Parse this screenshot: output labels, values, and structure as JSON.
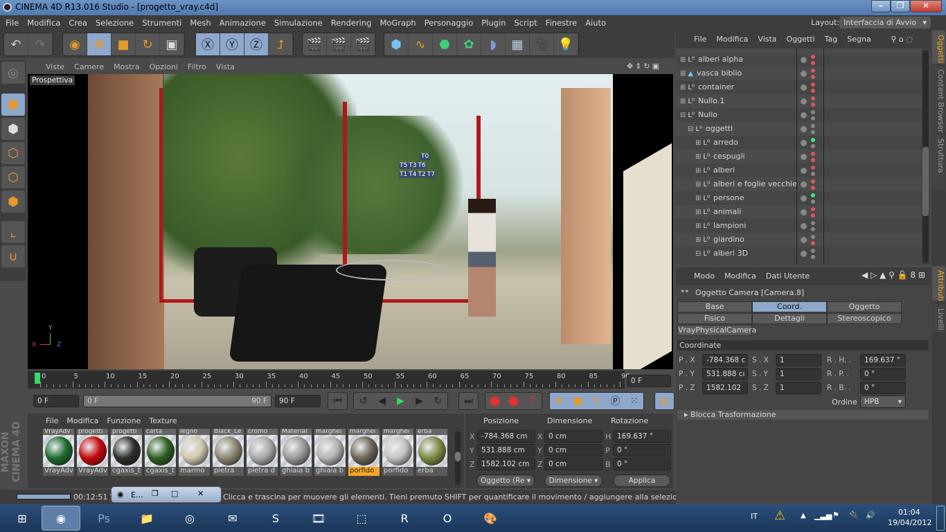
{
  "window": {
    "title": "CINEMA 4D R13.016 Studio - [progetto_vray.c4d]",
    "min": "–",
    "max": "❐",
    "close": "✕"
  },
  "menu": [
    "File",
    "Modifica",
    "Crea",
    "Selezione",
    "Strumenti",
    "Mesh",
    "Animazione",
    "Simulazione",
    "Rendering",
    "MoGraph",
    "Personaggio",
    "Plugin",
    "Script",
    "Finestre",
    "Aiuto"
  ],
  "layout": {
    "label": "Layout:",
    "value": "Interfaccia di Avvio"
  },
  "viewport": {
    "menu": [
      "Viste",
      "Camere",
      "Mostra",
      "Opzioni",
      "Filtro",
      "Vista"
    ],
    "label": "Prospettiva",
    "axes": {
      "x": "X",
      "y": "Y",
      "z": "Z"
    },
    "tags": [
      "T0",
      "T5",
      "T3",
      "T6",
      "T1",
      "T4",
      "T2",
      "T7"
    ]
  },
  "timeline": {
    "ticks": [
      "0",
      "5",
      "10",
      "15",
      "20",
      "25",
      "30",
      "35",
      "40",
      "45",
      "50",
      "55",
      "60",
      "65",
      "70",
      "75",
      "80",
      "85",
      "90"
    ],
    "current": "0 F",
    "start": "0 F",
    "range_start": "0 F",
    "range_end": "90 F",
    "end": "90 F"
  },
  "materials": {
    "menu": [
      "File",
      "Modifica",
      "Funzione",
      "Texture"
    ],
    "top_labels": [
      "VrayAdv",
      "progetti",
      "progetti",
      "carta",
      "legno",
      "Black_Le",
      "cromo",
      "Material",
      "marghei",
      "marghei",
      "marghei",
      "erba"
    ],
    "items": [
      {
        "name": "VrayAdv",
        "color": "#1f6b2e"
      },
      {
        "name": "VrayAdv",
        "color": "#c4080d"
      },
      {
        "name": "cgaxis_t",
        "color": "#2e2e2a"
      },
      {
        "name": "cgaxis_t",
        "color": "#2f5e22"
      },
      {
        "name": "marmo",
        "color": "#cfc7ad"
      },
      {
        "name": "pietra",
        "color": "#8c8670"
      },
      {
        "name": "pietra d",
        "color": "#a9a9a9"
      },
      {
        "name": "ghiaia b",
        "color": "#9a9a9a"
      },
      {
        "name": "ghiaia b",
        "color": "#b3b3b3"
      },
      {
        "name": "porfido",
        "color": "#6e6556",
        "selected": true
      },
      {
        "name": "porfido",
        "color": "#c3c3c3"
      },
      {
        "name": "erba",
        "color": "#7b8a45"
      }
    ],
    "brand": "MAXON CINEMA 4D"
  },
  "coords": {
    "headers": [
      "Posizione",
      "Dimensione",
      "Rotazione"
    ],
    "rows": [
      {
        "a": "X",
        "pos": "-784.368 cm",
        "b": "X",
        "dim": "0 cm",
        "c": "H",
        "rot": "169.637 °"
      },
      {
        "a": "Y",
        "pos": "531.888 cm",
        "b": "Y",
        "dim": "0 cm",
        "c": "P",
        "rot": "0 °"
      },
      {
        "a": "Z",
        "pos": "1582.102 cm",
        "b": "Z",
        "dim": "0 cm",
        "c": "B",
        "rot": "0 °"
      }
    ],
    "mode": "Oggetto (Re",
    "size": "Dimensione",
    "apply": "Applica"
  },
  "status": {
    "time": "00:12:51 Vr",
    "text": "Clicca e trascina per muovere gli elementi. Tieni premuto SHIFT per quantificare il movimento / aggiungere alla selezione in mod",
    "popup": "E..."
  },
  "objects": {
    "menu": [
      "File",
      "Modifica",
      "Vista",
      "Oggetti",
      "Tag",
      "Segna"
    ],
    "items": [
      {
        "name": "alberi alpha",
        "indent": 0,
        "top": "#e05555",
        "bot": "#e05555"
      },
      {
        "name": "vasca biblio",
        "indent": 0,
        "top": "#e05555",
        "bot": "#e05555",
        "icon": "cone"
      },
      {
        "name": "container",
        "indent": 0,
        "top": "#e05555",
        "bot": "#e05555"
      },
      {
        "name": "Nullo.1",
        "indent": 0,
        "top": "#e05555",
        "bot": "#e05555"
      },
      {
        "name": "Nullo",
        "indent": 0,
        "top": "#888",
        "bot": "#888",
        "open": true
      },
      {
        "name": "oggetti",
        "indent": 1,
        "top": "#888",
        "bot": "#888",
        "open": true
      },
      {
        "name": "arredo",
        "indent": 2,
        "top": "#4ee08a",
        "bot": "#888"
      },
      {
        "name": "cespugli",
        "indent": 2,
        "top": "#e05555",
        "bot": "#e05555"
      },
      {
        "name": "alberi",
        "indent": 2,
        "top": "#e05555",
        "bot": "#888"
      },
      {
        "name": "alberi e foglie vecchie",
        "indent": 2,
        "top": "#e05555",
        "bot": "#e05555"
      },
      {
        "name": "persone",
        "indent": 2,
        "top": "#4ee08a",
        "bot": "#888"
      },
      {
        "name": "animali",
        "indent": 2,
        "top": "#e05555",
        "bot": "#e05555"
      },
      {
        "name": "lampioni",
        "indent": 2,
        "top": "#888",
        "bot": "#888"
      },
      {
        "name": "giardino",
        "indent": 2,
        "top": "#888",
        "bot": "#e05555"
      },
      {
        "name": "alberi 3D",
        "indent": 2,
        "top": "#888",
        "bot": "#888",
        "open": true
      }
    ]
  },
  "attributes": {
    "menu": [
      "Modo",
      "Modifica",
      "Dati Utente"
    ],
    "title": "Oggetto Camera [Camera.8]",
    "tabs": [
      "Base",
      "Coord.",
      "Oggetto",
      "Fisico",
      "Dettagli",
      "Stereoscopico",
      "VrayPhysicalCamera"
    ],
    "active_tab": "Coord.",
    "section": "Coordinate",
    "rows": [
      {
        "p": "P . X",
        "pv": "-784.368 c",
        "s": "S . X",
        "sv": "1",
        "r": "R . H. .",
        "rv": "169.637 °"
      },
      {
        "p": "P . Y",
        "pv": "531.888 cı",
        "s": "S . Y",
        "sv": "1",
        "r": "R . P. .",
        "rv": "0 °"
      },
      {
        "p": "P . Z",
        "pv": "1582.102",
        "s": "S . Z",
        "sv": "1",
        "r": "R . B. .",
        "rv": "0 °"
      }
    ],
    "order_label": "Ordine",
    "order": "HPB",
    "lock": "Blocca Trasformazione"
  },
  "side_tabs": [
    "Oggetti",
    "Content Browser",
    "Struttura",
    "Attributi",
    "Livelli"
  ],
  "taskbar": {
    "lang": "IT",
    "time": "01:04",
    "date": "19/04/2012",
    "apps": [
      "windows-start",
      "cinema4d",
      "photoshop",
      "explorer",
      "chrome",
      "outlook",
      "skype",
      "video",
      "autocad",
      "vray",
      "opera",
      "paint"
    ]
  }
}
